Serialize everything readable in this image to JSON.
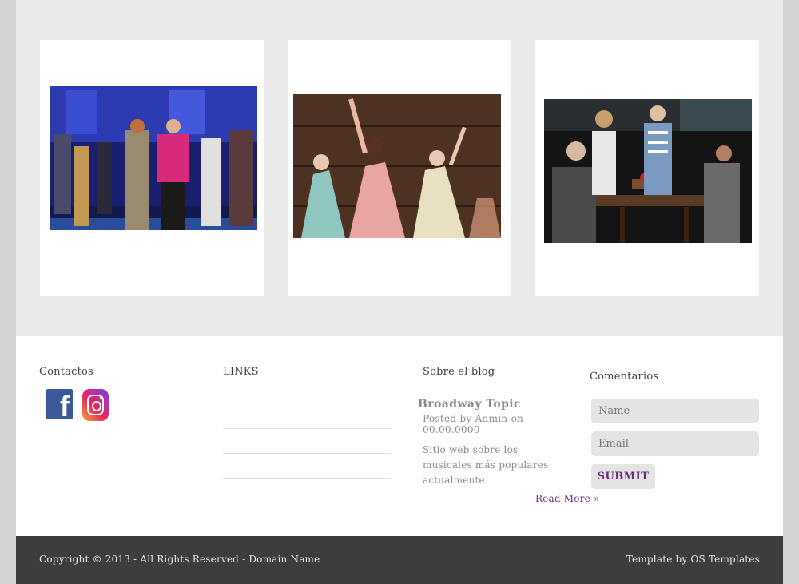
{
  "gallery": {
    "images": [
      {
        "alt": "Broadway stage scene with performers in pink jacket and sequined gown"
      },
      {
        "alt": "Three performers in period gowns raising arms on stage"
      },
      {
        "alt": "Family dinner table scene on stage"
      }
    ]
  },
  "footer": {
    "contact": {
      "title": "Contactos",
      "icons": [
        "facebook-icon",
        "instagram-icon"
      ]
    },
    "links": {
      "title": "LINKS",
      "items": [
        "",
        "",
        "",
        ""
      ]
    },
    "blog": {
      "title": "Sobre el blog",
      "post_title": "Broadway Topic",
      "post_meta": "Posted by Admin on 00.00.0000",
      "post_body": "Sitio web sobre los musicales más populares actualmente",
      "read_more": "Read More »"
    },
    "comments": {
      "title": "Comentarios",
      "name_placeholder": "Name",
      "email_placeholder": "Email",
      "submit_label": "SUBMIT"
    }
  },
  "copyright": {
    "left": "Copyright © 2013 - All Rights Reserved - Domain Name",
    "right": "Template by OS Templates"
  },
  "colors": {
    "accent": "#6b2a7a",
    "footer_bar": "#3d3d3d",
    "gallery_bg": "#eaeaea"
  }
}
